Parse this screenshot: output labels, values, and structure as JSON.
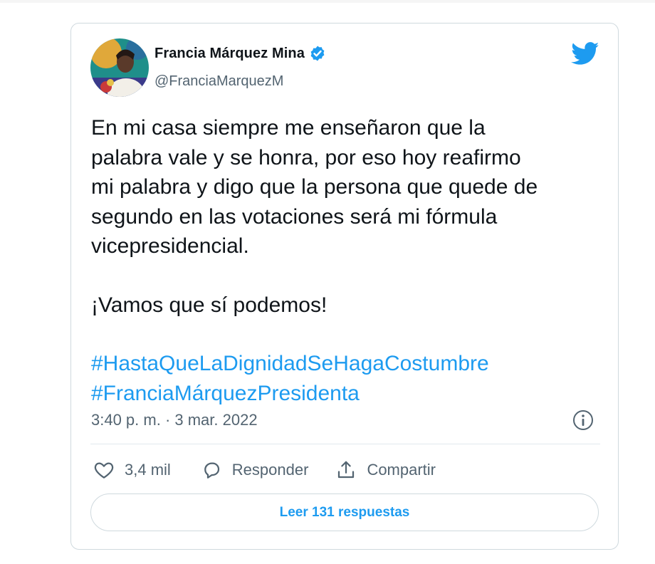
{
  "tweet": {
    "author_name": "Francia Márquez Mina",
    "handle": "@FranciaMarquezM",
    "text_lines": [
      "En mi casa siempre me enseñaron que la",
      "palabra vale y se honra, por eso hoy reafirmo",
      "mi palabra y digo que la persona que quede de",
      "segundo en las votaciones será mi fórmula",
      "vicepresidencial."
    ],
    "text_line_2": "¡Vamos que sí podemos!",
    "hashtags": [
      "#HastaQueLaDignidadSeHagaCostumbre",
      "#FranciaMárquezPresidenta"
    ],
    "timestamp": "3:40 p. m. · 3 mar. 2022",
    "likes": "3,4 mil",
    "reply_label": "Responder",
    "share_label": "Compartir",
    "read_replies_label": "Leer 131 respuestas"
  },
  "icons": {
    "verified": "verified-badge-icon",
    "bird": "twitter-bird-icon",
    "info": "info-icon",
    "heart": "heart-icon",
    "reply": "reply-bubble-icon",
    "share": "share-icon"
  },
  "colors": {
    "accent": "#1d9bf0",
    "text": "#0f1419",
    "secondary": "#536471",
    "border": "#cfd9de"
  }
}
